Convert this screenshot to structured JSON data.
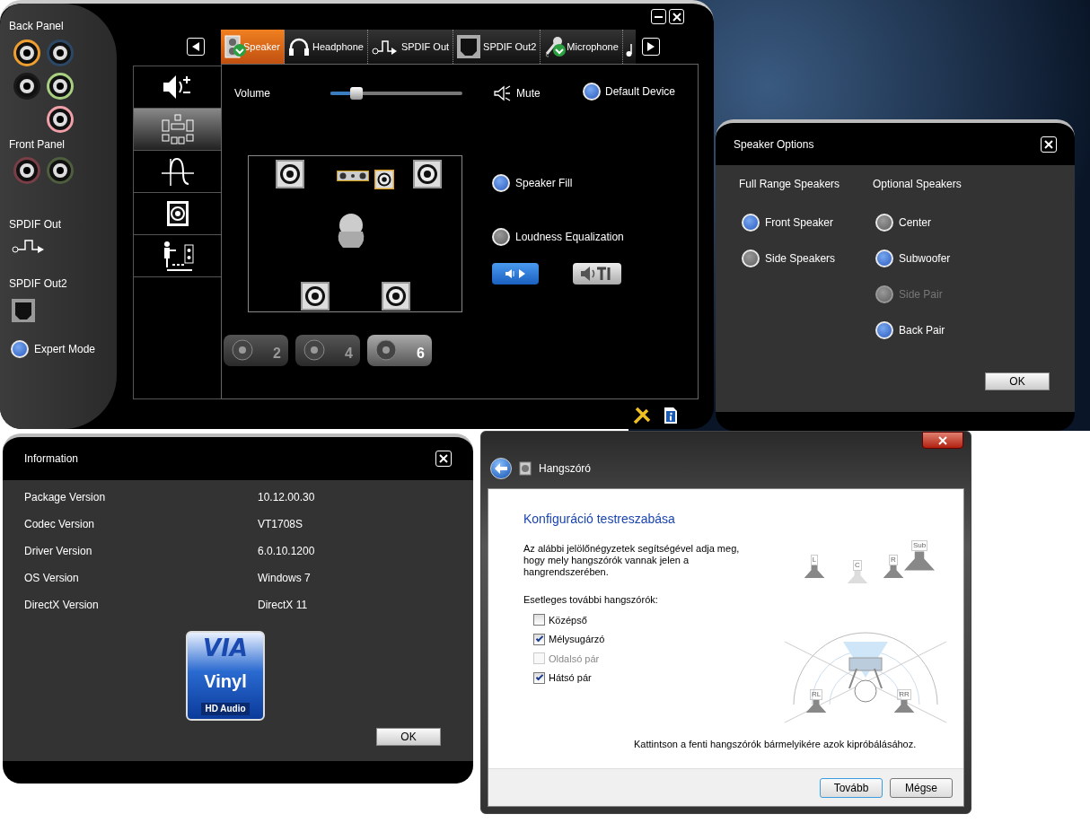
{
  "main_window": {
    "back_panel": {
      "label": "Back Panel",
      "jacks": [
        {
          "color": "#f0a030"
        },
        {
          "color": "#2c4866"
        },
        {
          "color": "#1a1a1a"
        },
        {
          "color": "#a8d080"
        },
        {
          "color": "#f0a0a8"
        }
      ]
    },
    "front_panel": {
      "label": "Front Panel",
      "jacks": [
        {
          "color": "#7a3e46"
        },
        {
          "color": "#4e5e3e"
        }
      ]
    },
    "spdif_out": {
      "label": "SPDIF Out"
    },
    "spdif_out2": {
      "label": "SPDIF Out2"
    },
    "expert_mode": {
      "label": "Expert Mode",
      "on": true
    },
    "tabs": [
      {
        "label": "Speaker",
        "selected": true,
        "connected": true
      },
      {
        "label": "Headphone",
        "selected": false,
        "connected": false
      },
      {
        "label": "SPDIF Out",
        "selected": false,
        "connected": false
      },
      {
        "label": "SPDIF Out2",
        "selected": false,
        "connected": false
      },
      {
        "label": "Microphone",
        "selected": false,
        "connected": true
      }
    ],
    "side_nav": [
      {
        "selected": false
      },
      {
        "selected": true
      },
      {
        "selected": false
      },
      {
        "selected": false
      },
      {
        "selected": false
      }
    ],
    "volume": {
      "label": "Volume",
      "level": 0.2
    },
    "mute": {
      "label": "Mute"
    },
    "default_device": {
      "label": "Default Device",
      "on": true
    },
    "speaker_fill": {
      "label": "Speaker Fill",
      "on": true
    },
    "loudness_equalization": {
      "label": "Loudness Equalization",
      "on": false
    },
    "channel_presets": [
      {
        "label": "2",
        "selected": false
      },
      {
        "label": "4",
        "selected": false
      },
      {
        "label": "6",
        "selected": true
      }
    ]
  },
  "speaker_options": {
    "title": "Speaker Options",
    "groups": [
      {
        "heading": "Full Range Speakers",
        "options": [
          {
            "label": "Front Speaker",
            "on": true,
            "disabled": false
          },
          {
            "label": "Side Speakers",
            "on": false,
            "disabled": false
          }
        ]
      },
      {
        "heading": "Optional Speakers",
        "options": [
          {
            "label": "Center",
            "on": false,
            "disabled": false
          },
          {
            "label": "Subwoofer",
            "on": true,
            "disabled": false
          },
          {
            "label": "Side Pair",
            "on": false,
            "disabled": true
          },
          {
            "label": "Back Pair",
            "on": true,
            "disabled": false
          }
        ]
      }
    ],
    "ok": "OK"
  },
  "information": {
    "title": "Information",
    "rows": [
      {
        "label": "Package Version",
        "value": "10.12.00.30"
      },
      {
        "label": "Codec Version",
        "value": "VT1708S"
      },
      {
        "label": "Driver Version",
        "value": "6.0.10.1200"
      },
      {
        "label": "OS Version",
        "value": "Windows 7"
      },
      {
        "label": "DirectX Version",
        "value": "DirectX 11"
      }
    ],
    "logo": {
      "brand": "VIA",
      "product": "Vinyl",
      "subtitle": "HD Audio"
    },
    "ok": "OK"
  },
  "speaker_setup": {
    "title": "Hangszóró",
    "heading": "Konfiguráció testreszabása",
    "description": "Az alábbi jelölőnégyzetek segítségével adja meg, hogy mely hangszórók vannak jelen a hangrendszerében.",
    "options_label": "Esetleges további hangszórók:",
    "options": [
      {
        "label": "Középső",
        "checked": false,
        "disabled": false
      },
      {
        "label": "Mélysugárzó",
        "checked": true,
        "disabled": false
      },
      {
        "label": "Oldalsó pár",
        "checked": false,
        "disabled": true
      },
      {
        "label": "Hátsó pár",
        "checked": true,
        "disabled": false
      }
    ],
    "diagram_speakers": [
      {
        "label": "L",
        "active": true
      },
      {
        "label": "C",
        "active": false
      },
      {
        "label": "R",
        "active": true
      },
      {
        "label": "Sub",
        "active": true
      },
      {
        "label": "RL",
        "active": true
      },
      {
        "label": "RR",
        "active": true
      }
    ],
    "hint": "Kattintson a fenti hangszórók bármelyikére azok kipróbálásához.",
    "buttons": [
      {
        "label": "Tovább",
        "default": true
      },
      {
        "label": "Mégse",
        "default": false
      }
    ]
  }
}
